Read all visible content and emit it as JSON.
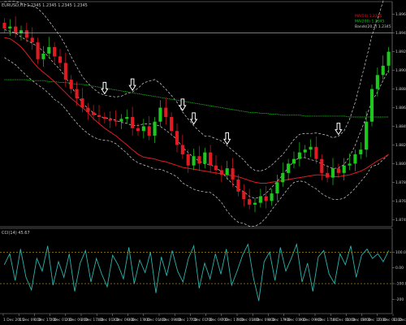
{
  "chart_data": {
    "type": "line",
    "main": {
      "title": "EURUSD,H1  1.2345 1.2345 1.2345 1.2345",
      "legend": [
        {
          "name": "MA(50) 1.2345",
          "color": "#e11b22"
        },
        {
          "name": "MA(200) 1.2345",
          "color": "#1ec71e"
        },
        {
          "name": "Bands(20,2) 1.2345",
          "color": "#cfcfcf"
        }
      ],
      "y_ticks": [
        "1.8960",
        "1.8940",
        "1.8920",
        "1.8900",
        "1.8880",
        "1.8860",
        "1.8840",
        "1.8820",
        "1.8800",
        "1.8780",
        "1.8760",
        "1.8740"
      ],
      "ylim": [
        1.8735,
        1.8965
      ],
      "current_price": 1.894,
      "close": [
        1.8945,
        1.8947,
        1.894,
        1.8943,
        1.8935,
        1.893,
        1.8912,
        1.8918,
        1.8925,
        1.8915,
        1.8908,
        1.889,
        1.888,
        1.887,
        1.886,
        1.8855,
        1.8852,
        1.885,
        1.8848,
        1.8846,
        1.8845,
        1.8848,
        1.885,
        1.8838,
        1.8835,
        1.884,
        1.883,
        1.8845,
        1.886,
        1.885,
        1.8835,
        1.882,
        1.881,
        1.8798,
        1.8808,
        1.88,
        1.8812,
        1.8798,
        1.8793,
        1.8788,
        1.8795,
        1.8783,
        1.877,
        1.8762,
        1.8756,
        1.8758,
        1.8765,
        1.876,
        1.8768,
        1.878,
        1.879,
        1.88,
        1.8805,
        1.8812,
        1.8815,
        1.8818,
        1.8805,
        1.879,
        1.8785,
        1.8795,
        1.879,
        1.8798,
        1.88,
        1.881,
        1.8815,
        1.8845,
        1.888,
        1.8895,
        1.8905,
        1.892
      ],
      "ma_red": [
        1.8935,
        1.8934,
        1.893,
        1.8925,
        1.8918,
        1.891,
        1.8903,
        1.8898,
        1.8893,
        1.8888,
        1.8882,
        1.8876,
        1.887,
        1.8865,
        1.886,
        1.8855,
        1.8848,
        1.8843,
        1.8838,
        1.8834,
        1.883,
        1.8825,
        1.882,
        1.8815,
        1.881,
        1.8807,
        1.8806,
        1.8805,
        1.8803,
        1.8802,
        1.88,
        1.8798,
        1.8796,
        1.8795,
        1.8794,
        1.8793,
        1.8792,
        1.8791,
        1.879,
        1.8789,
        1.8788,
        1.8787,
        1.8786,
        1.8784,
        1.8782,
        1.878,
        1.8779,
        1.8779,
        1.878,
        1.8781,
        1.8782,
        1.8783,
        1.8784,
        1.8785,
        1.8786,
        1.8787,
        1.8788,
        1.8788,
        1.8787,
        1.8786,
        1.8786,
        1.8787,
        1.8788,
        1.879,
        1.8792,
        1.8795,
        1.8799,
        1.8803,
        1.8806,
        1.881
      ],
      "ma_green": [
        1.889,
        1.889,
        1.889,
        1.889,
        1.889,
        1.8889,
        1.8889,
        1.8889,
        1.8888,
        1.8888,
        1.8887,
        1.8887,
        1.8886,
        1.8885,
        1.8885,
        1.8884,
        1.8883,
        1.8882,
        1.8881,
        1.888,
        1.8879,
        1.8878,
        1.8877,
        1.8876,
        1.8875,
        1.8874,
        1.8873,
        1.8872,
        1.8871,
        1.887,
        1.8869,
        1.8868,
        1.8867,
        1.8866,
        1.8865,
        1.8864,
        1.8863,
        1.8862,
        1.8861,
        1.886,
        1.8859,
        1.8858,
        1.8857,
        1.8856,
        1.8855,
        1.8855,
        1.8854,
        1.8854,
        1.8853,
        1.8853,
        1.8852,
        1.8852,
        1.8852,
        1.8852,
        1.8851,
        1.8851,
        1.8851,
        1.8851,
        1.8851,
        1.8851,
        1.8851,
        1.8851,
        1.885,
        1.885,
        1.885,
        1.885,
        1.885,
        1.885,
        1.885,
        1.885
      ],
      "bands_width": [
        0.003,
        0.0032,
        0.0034,
        0.0036,
        0.0038,
        0.004,
        0.0041,
        0.004,
        0.0039,
        0.0038,
        0.0036,
        0.0034,
        0.0032,
        0.003,
        0.0028,
        0.0027,
        0.0026,
        0.0025,
        0.0024,
        0.0024,
        0.0025,
        0.0028,
        0.0032,
        0.0036,
        0.004,
        0.0044,
        0.0046,
        0.0048,
        0.0046,
        0.0044,
        0.0042,
        0.004,
        0.0038,
        0.0036,
        0.0034,
        0.0032,
        0.003,
        0.003,
        0.0031,
        0.0033,
        0.0035,
        0.0036,
        0.0036,
        0.0034,
        0.0032,
        0.003,
        0.0028,
        0.0026,
        0.0024,
        0.0023,
        0.0022,
        0.0022,
        0.0023,
        0.0025,
        0.0026,
        0.0028,
        0.003,
        0.0032,
        0.0033,
        0.0033,
        0.0034,
        0.0036,
        0.004,
        0.0046,
        0.0054,
        0.0062,
        0.007,
        0.0078,
        0.0085,
        0.009
      ]
    },
    "arrows_at": [
      18,
      23,
      32,
      34,
      40,
      60
    ],
    "sub": {
      "title": "CCI(14) 45.67",
      "y_ticks": [
        "100.00",
        "0.00",
        "-100.00",
        "-200"
      ],
      "ylim": [
        -260,
        200
      ],
      "levels": [
        100,
        -100
      ],
      "values": [
        20,
        90,
        -80,
        120,
        -60,
        -140,
        60,
        -20,
        140,
        -110,
        40,
        -60,
        90,
        -150,
        30,
        110,
        -90,
        60,
        -40,
        -120,
        80,
        20,
        -70,
        130,
        -100,
        50,
        -30,
        100,
        -160,
        70,
        -50,
        110,
        -20,
        -90,
        60,
        140,
        -130,
        30,
        -70,
        90,
        -40,
        120,
        -110,
        -20,
        80,
        150,
        -60,
        -210,
        40,
        100,
        -80,
        130,
        -20,
        60,
        150,
        -90,
        30,
        -150,
        70,
        110,
        -40,
        -100,
        90,
        20,
        140,
        -60,
        80,
        120,
        60,
        90,
        40,
        110
      ]
    },
    "x_ticks": [
      "1 Dec 2015",
      "1 Dec 09:00",
      "1 Dec 17:00",
      "2 Dec 01:00",
      "2 Dec 09:00",
      "2 Dec 17:00",
      "3 Dec 01:00",
      "3 Dec 09:00",
      "3 Dec 17:00",
      "4 Dec 01:00",
      "4 Dec 09:00",
      "4 Dec 17:00",
      "7 Dec 01:00",
      "7 Dec 09:00",
      "7 Dec 17:00",
      "8 Dec 01:00",
      "8 Dec 09:00",
      "8 Dec 17:00",
      "9 Dec 01:00",
      "9 Dec 09:00",
      "9 Dec 17:00",
      "10 Dec 01:00",
      "10 Dec 09:00",
      "10 Dec 17:00",
      "11 Dec 01:00",
      "11 Dec 09:00"
    ]
  }
}
